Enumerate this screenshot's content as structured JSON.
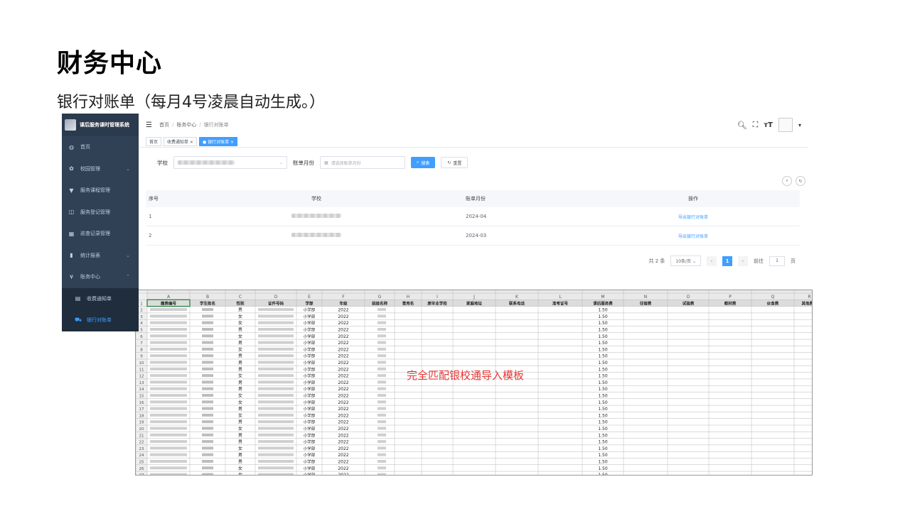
{
  "slide": {
    "title": "财务中心",
    "subtitle": "银行对账单（每月4号凌晨自动生成。）"
  },
  "app": {
    "brand": "课后服务课时管理系统",
    "sidebar": [
      {
        "icon": "dashboard-icon",
        "label": "首页"
      },
      {
        "icon": "gear-icon",
        "label": "校园管理",
        "chevron": "⌄"
      },
      {
        "icon": "shirt-icon",
        "label": "服务课程管理"
      },
      {
        "icon": "book-icon",
        "label": "服务登记管理"
      },
      {
        "icon": "calendar-icon",
        "label": "巡查记录管理"
      },
      {
        "icon": "bar-chart-icon",
        "label": "统计报表",
        "chevron": "⌄"
      },
      {
        "icon": "yen-icon",
        "label": "账务中心",
        "chevron": "⌃"
      }
    ],
    "sidebar_sub": [
      {
        "icon": "list-icon",
        "label": "收费通知单",
        "active": false
      },
      {
        "icon": "cart-icon",
        "label": "银行对账单",
        "active": true
      }
    ],
    "breadcrumb": [
      "首页",
      "账务中心",
      "银行对账单"
    ],
    "tags": [
      {
        "label": "首页",
        "active": false
      },
      {
        "label": "收费通知单 ×",
        "active": false
      },
      {
        "label": "● 银行对账单 ×",
        "active": true
      }
    ],
    "filters": {
      "school_label": "学校",
      "month_label": "账单月份",
      "month_placeholder": "请选择账单月份",
      "search_label": "搜索",
      "reset_label": "重置"
    },
    "table": {
      "headers": [
        "序号",
        "学校",
        "账单月份",
        "操作"
      ],
      "rows": [
        {
          "index": "1",
          "month": "2024-04",
          "action": "导出银行对账单"
        },
        {
          "index": "2",
          "month": "2024-03",
          "action": "导出银行对账单"
        }
      ]
    },
    "pager": {
      "total": "共 2 条",
      "page_size": "10条/页",
      "current": "1",
      "goto_label": "前往",
      "goto_value": "1",
      "page_unit": "页"
    }
  },
  "sheet": {
    "columns": [
      "A",
      "B",
      "C",
      "D",
      "E",
      "F",
      "G",
      "H",
      "I",
      "J",
      "K",
      "L",
      "M",
      "N",
      "O",
      "P",
      "Q",
      "R"
    ],
    "headers": [
      "缴费编号",
      "学生姓名",
      "性别",
      "证件号码",
      "学部",
      "年级",
      "班级名称",
      "曾用名",
      "原毕业学校",
      "家庭地址",
      "联系电话",
      "准考证号",
      "课后服务费",
      "住宿费",
      "试验费",
      "教材费",
      "伙食费",
      "其他费用"
    ],
    "genders": [
      "男",
      "女",
      "女",
      "男",
      "女",
      "男",
      "女",
      "男",
      "男",
      "男",
      "女",
      "男",
      "男",
      "女",
      "女",
      "男",
      "女",
      "男",
      "女",
      "男",
      "男",
      "女",
      "男",
      "男",
      "女",
      "女"
    ],
    "division": "小学部",
    "year": "2022",
    "fee": "1.50",
    "annotation": "完全匹配银校通导入模板"
  }
}
